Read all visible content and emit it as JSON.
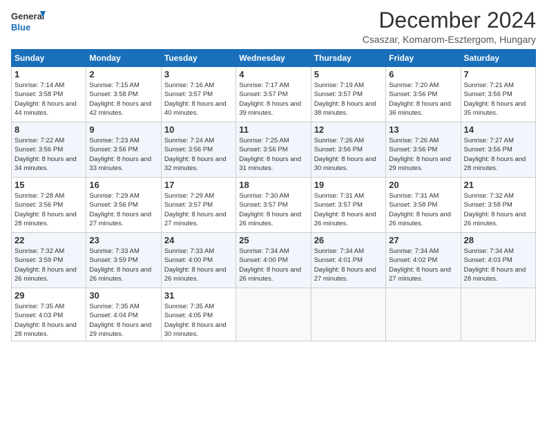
{
  "logo": {
    "line1": "General",
    "line2": "Blue"
  },
  "title": "December 2024",
  "subtitle": "Csaszar, Komarom-Esztergom, Hungary",
  "headers": [
    "Sunday",
    "Monday",
    "Tuesday",
    "Wednesday",
    "Thursday",
    "Friday",
    "Saturday"
  ],
  "weeks": [
    [
      {
        "day": "1",
        "info": "Sunrise: 7:14 AM\nSunset: 3:58 PM\nDaylight: 8 hours and 44 minutes."
      },
      {
        "day": "2",
        "info": "Sunrise: 7:15 AM\nSunset: 3:58 PM\nDaylight: 8 hours and 42 minutes."
      },
      {
        "day": "3",
        "info": "Sunrise: 7:16 AM\nSunset: 3:57 PM\nDaylight: 8 hours and 40 minutes."
      },
      {
        "day": "4",
        "info": "Sunrise: 7:17 AM\nSunset: 3:57 PM\nDaylight: 8 hours and 39 minutes."
      },
      {
        "day": "5",
        "info": "Sunrise: 7:19 AM\nSunset: 3:57 PM\nDaylight: 8 hours and 38 minutes."
      },
      {
        "day": "6",
        "info": "Sunrise: 7:20 AM\nSunset: 3:56 PM\nDaylight: 8 hours and 36 minutes."
      },
      {
        "day": "7",
        "info": "Sunrise: 7:21 AM\nSunset: 3:56 PM\nDaylight: 8 hours and 35 minutes."
      }
    ],
    [
      {
        "day": "8",
        "info": "Sunrise: 7:22 AM\nSunset: 3:56 PM\nDaylight: 8 hours and 34 minutes."
      },
      {
        "day": "9",
        "info": "Sunrise: 7:23 AM\nSunset: 3:56 PM\nDaylight: 8 hours and 33 minutes."
      },
      {
        "day": "10",
        "info": "Sunrise: 7:24 AM\nSunset: 3:56 PM\nDaylight: 8 hours and 32 minutes."
      },
      {
        "day": "11",
        "info": "Sunrise: 7:25 AM\nSunset: 3:56 PM\nDaylight: 8 hours and 31 minutes."
      },
      {
        "day": "12",
        "info": "Sunrise: 7:26 AM\nSunset: 3:56 PM\nDaylight: 8 hours and 30 minutes."
      },
      {
        "day": "13",
        "info": "Sunrise: 7:26 AM\nSunset: 3:56 PM\nDaylight: 8 hours and 29 minutes."
      },
      {
        "day": "14",
        "info": "Sunrise: 7:27 AM\nSunset: 3:56 PM\nDaylight: 8 hours and 28 minutes."
      }
    ],
    [
      {
        "day": "15",
        "info": "Sunrise: 7:28 AM\nSunset: 3:56 PM\nDaylight: 8 hours and 28 minutes."
      },
      {
        "day": "16",
        "info": "Sunrise: 7:29 AM\nSunset: 3:56 PM\nDaylight: 8 hours and 27 minutes."
      },
      {
        "day": "17",
        "info": "Sunrise: 7:29 AM\nSunset: 3:57 PM\nDaylight: 8 hours and 27 minutes."
      },
      {
        "day": "18",
        "info": "Sunrise: 7:30 AM\nSunset: 3:57 PM\nDaylight: 8 hours and 26 minutes."
      },
      {
        "day": "19",
        "info": "Sunrise: 7:31 AM\nSunset: 3:57 PM\nDaylight: 8 hours and 26 minutes."
      },
      {
        "day": "20",
        "info": "Sunrise: 7:31 AM\nSunset: 3:58 PM\nDaylight: 8 hours and 26 minutes."
      },
      {
        "day": "21",
        "info": "Sunrise: 7:32 AM\nSunset: 3:58 PM\nDaylight: 8 hours and 26 minutes."
      }
    ],
    [
      {
        "day": "22",
        "info": "Sunrise: 7:32 AM\nSunset: 3:59 PM\nDaylight: 8 hours and 26 minutes."
      },
      {
        "day": "23",
        "info": "Sunrise: 7:33 AM\nSunset: 3:59 PM\nDaylight: 8 hours and 26 minutes."
      },
      {
        "day": "24",
        "info": "Sunrise: 7:33 AM\nSunset: 4:00 PM\nDaylight: 8 hours and 26 minutes."
      },
      {
        "day": "25",
        "info": "Sunrise: 7:34 AM\nSunset: 4:00 PM\nDaylight: 8 hours and 26 minutes."
      },
      {
        "day": "26",
        "info": "Sunrise: 7:34 AM\nSunset: 4:01 PM\nDaylight: 8 hours and 27 minutes."
      },
      {
        "day": "27",
        "info": "Sunrise: 7:34 AM\nSunset: 4:02 PM\nDaylight: 8 hours and 27 minutes."
      },
      {
        "day": "28",
        "info": "Sunrise: 7:34 AM\nSunset: 4:03 PM\nDaylight: 8 hours and 28 minutes."
      }
    ],
    [
      {
        "day": "29",
        "info": "Sunrise: 7:35 AM\nSunset: 4:03 PM\nDaylight: 8 hours and 28 minutes."
      },
      {
        "day": "30",
        "info": "Sunrise: 7:35 AM\nSunset: 4:04 PM\nDaylight: 8 hours and 29 minutes."
      },
      {
        "day": "31",
        "info": "Sunrise: 7:35 AM\nSunset: 4:05 PM\nDaylight: 8 hours and 30 minutes."
      },
      null,
      null,
      null,
      null
    ]
  ]
}
